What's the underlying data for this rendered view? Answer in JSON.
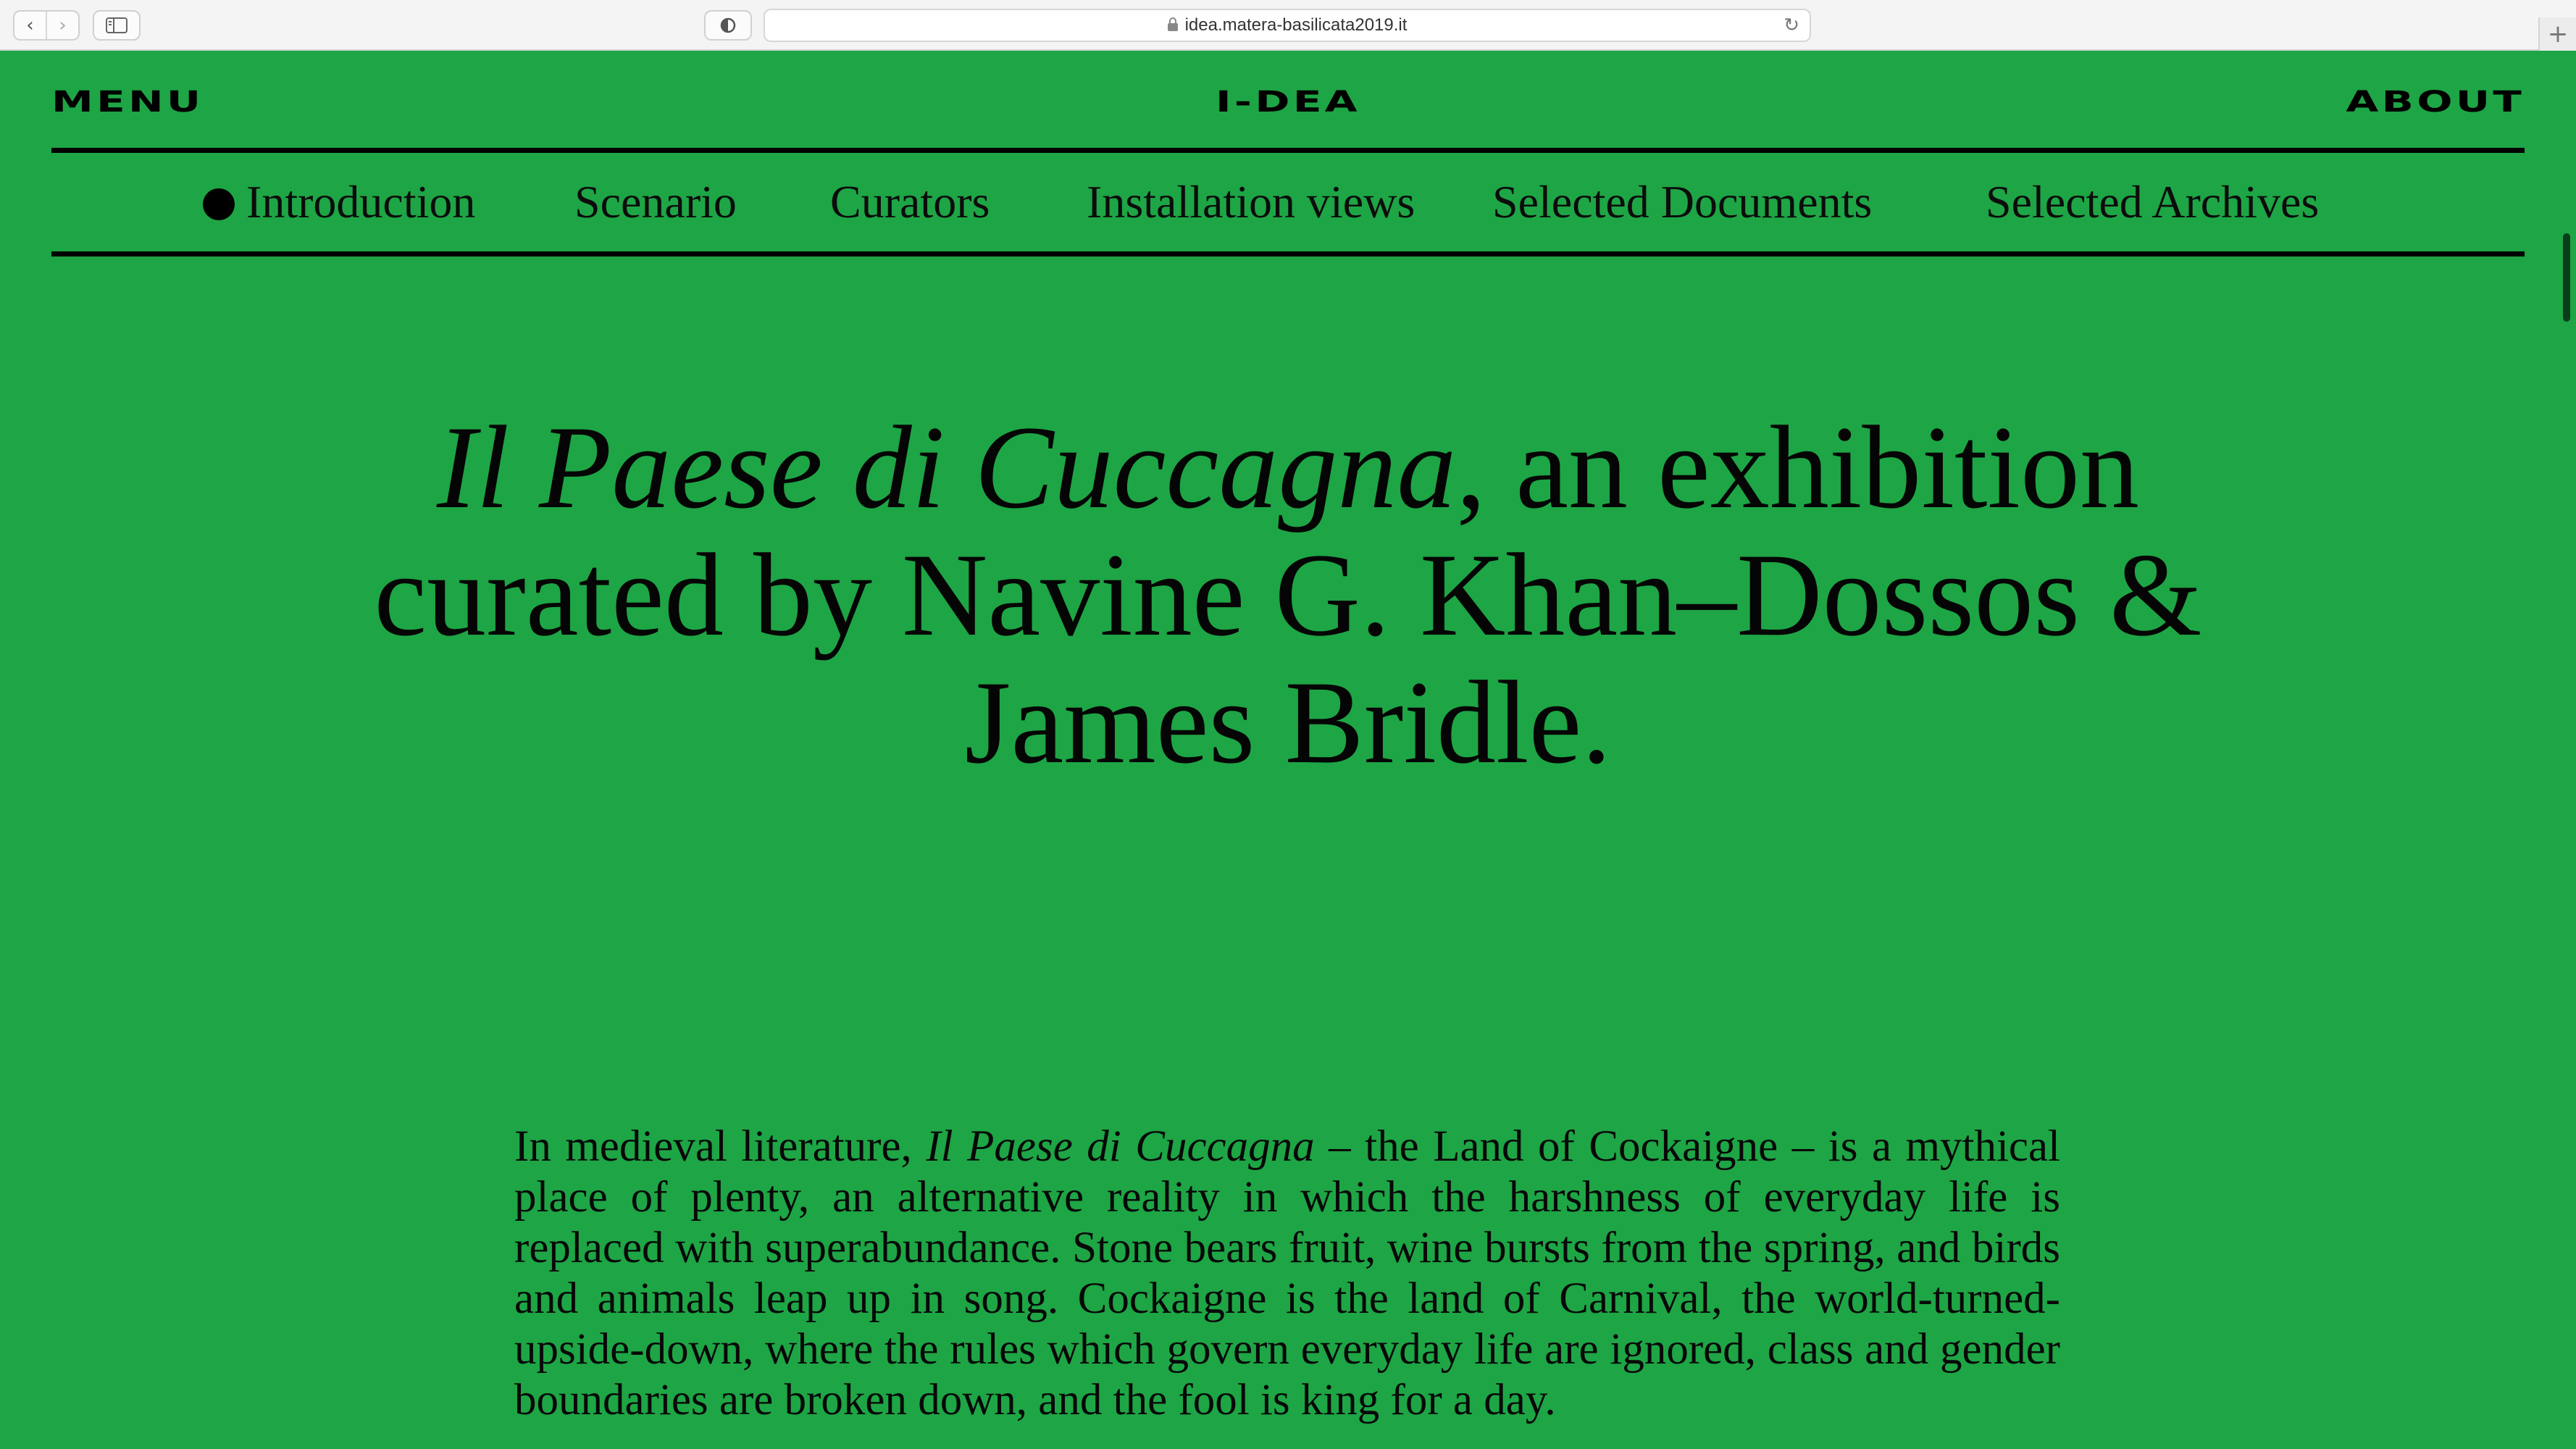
{
  "browser": {
    "back_icon": "‹",
    "forward_icon": "›",
    "url": "idea.matera-basilicata2019.it",
    "reload_icon": "↻",
    "new_tab_icon": "+"
  },
  "header": {
    "menu_label": "MENU",
    "logo_text": "I-DEA",
    "about_label": "ABOUT"
  },
  "section_nav": {
    "items": [
      {
        "label": "Introduction",
        "active": true
      },
      {
        "label": "Scenario",
        "active": false
      },
      {
        "label": "Curators",
        "active": false
      },
      {
        "label": "Installation views",
        "active": false
      },
      {
        "label": "Selected Documents",
        "active": false
      },
      {
        "label": "Selected Archives",
        "active": false
      }
    ]
  },
  "headline": {
    "title_italic": "Il Paese di Cuccagna",
    "title_rest": ", an exhibition curated by Navine G. Khan–Dossos & James Bridle."
  },
  "body": {
    "intro_prefix": "In medieval literature, ",
    "intro_italic": "Il Paese di Cuccagna",
    "intro_rest": " – the Land of Cockaigne – is a mythi­cal place of plenty, an alternative reality in which the harshness of everyday life is replaced with superabundance. Stone bears fruit, wine bursts from the spring, and birds and animals leap up in song. Cockaigne is the land of Carnival, the world-turned-upside-down, where the rules which govern everyday life are ig­nored, class and gender boundaries are broken down, and the fool is king for a day."
  },
  "colors": {
    "page_background": "#1ea545",
    "text": "#000000",
    "scrollbar_thumb": "#0b3d1a"
  }
}
